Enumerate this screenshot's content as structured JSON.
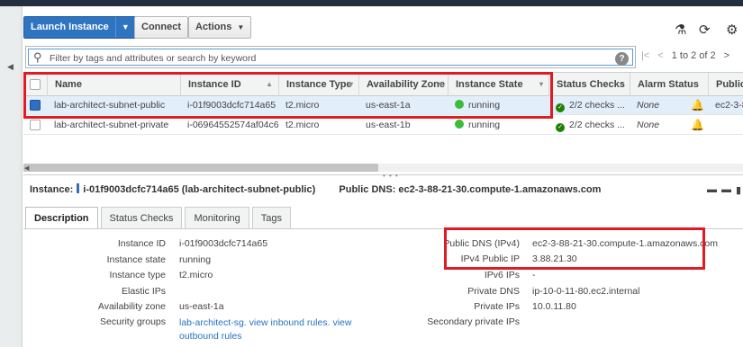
{
  "toolbar": {
    "launch_label": "Launch Instance",
    "connect_label": "Connect",
    "actions_label": "Actions",
    "icons": [
      "flask-icon",
      "refresh-icon",
      "gear-icon"
    ]
  },
  "search": {
    "placeholder": "Filter by tags and attributes or search by keyword"
  },
  "pager": {
    "text": "1 to 2 of 2"
  },
  "columns": [
    "Name",
    "Instance ID",
    "Instance Type",
    "Availability Zone",
    "Instance State",
    "Status Checks",
    "Alarm Status",
    "Public"
  ],
  "rows": [
    {
      "name": "lab-architect-subnet-public",
      "instance_id": "i-01f9003dcfc714a65",
      "type": "t2.micro",
      "zone": "us-east-1a",
      "state": "running",
      "status_checks": "2/2 checks ...",
      "alarm": "None",
      "public": "ec2-3-8",
      "selected": true
    },
    {
      "name": "lab-architect-subnet-private",
      "instance_id": "i-06964552574af04c6",
      "type": "t2.micro",
      "zone": "us-east-1b",
      "state": "running",
      "status_checks": "2/2 checks ...",
      "alarm": "None",
      "public": "",
      "selected": false
    }
  ],
  "detail": {
    "instance_label": "Instance:",
    "instance_value": "i-01f9003dcfc714a65 (lab-architect-subnet-public)",
    "dns_label": "Public DNS:",
    "dns_value": "ec2-3-88-21-30.compute-1.amazonaws.com"
  },
  "tabs": [
    "Description",
    "Status Checks",
    "Monitoring",
    "Tags"
  ],
  "description_left": [
    {
      "label": "Instance ID",
      "value": "i-01f9003dcfc714a65"
    },
    {
      "label": "Instance state",
      "value": "running"
    },
    {
      "label": "Instance type",
      "value": "t2.micro"
    },
    {
      "label": "Elastic IPs",
      "value": ""
    },
    {
      "label": "Availability zone",
      "value": "us-east-1a"
    },
    {
      "label": "Security groups",
      "value": "lab-architect-sg.",
      "link1": "view inbound rules",
      "sep": ".",
      "link2": "view outbound rules"
    }
  ],
  "description_right": [
    {
      "label": "Public DNS (IPv4)",
      "value": "ec2-3-88-21-30.compute-1.amazonaws.com"
    },
    {
      "label": "IPv4 Public IP",
      "value": "3.88.21.30"
    },
    {
      "label": "IPv6 IPs",
      "value": "-"
    },
    {
      "label": "Private DNS",
      "value": "ip-10-0-11-80.ec2.internal"
    },
    {
      "label": "Private IPs",
      "value": "10.0.11.80"
    },
    {
      "label": "Secondary private IPs",
      "value": ""
    }
  ],
  "colors": {
    "accent": "#2f74c0",
    "highlight_box": "#e01b24",
    "running": "#3dbb3d"
  }
}
